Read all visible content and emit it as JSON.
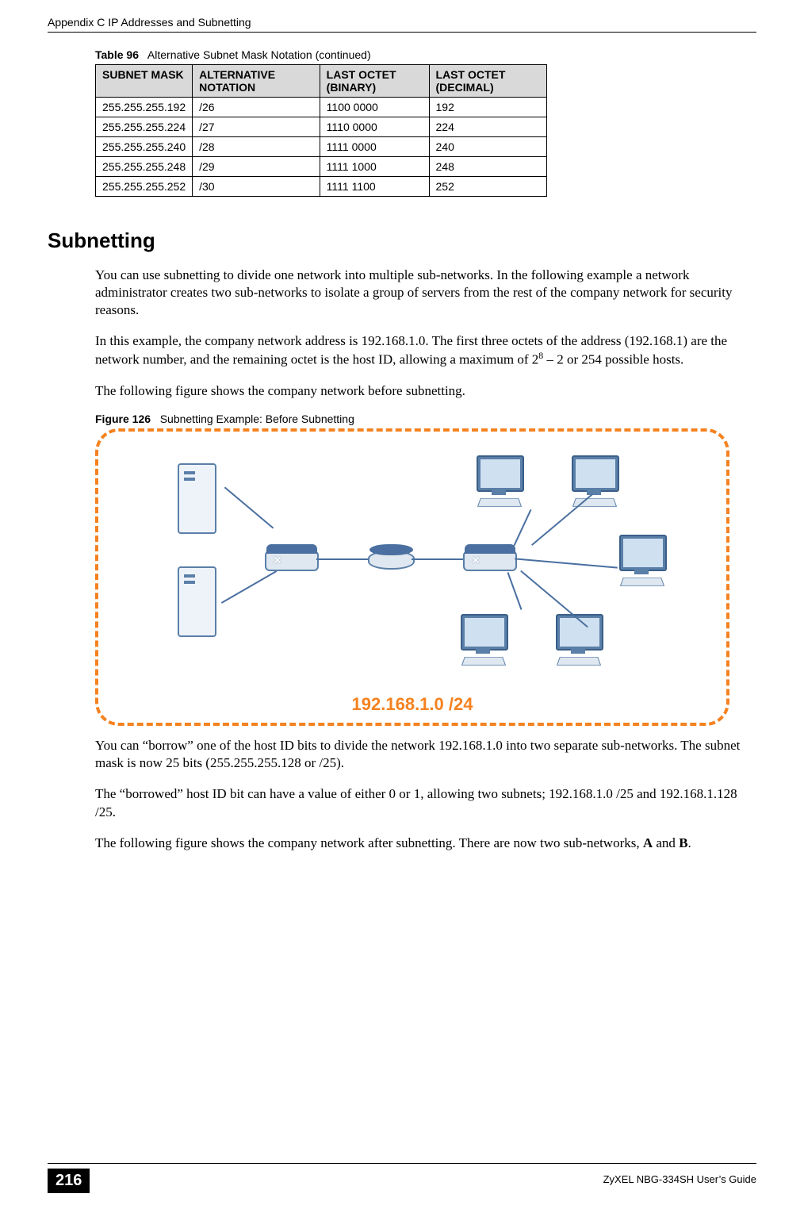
{
  "header": {
    "text": "Appendix C IP Addresses and Subnetting"
  },
  "table": {
    "caption_prefix": "Table 96",
    "caption_text": "Alternative Subnet Mask Notation (continued)",
    "headers": [
      "SUBNET MASK",
      "ALTERNATIVE NOTATION",
      "LAST OCTET (BINARY)",
      "LAST OCTET (DECIMAL)"
    ],
    "rows": [
      [
        "255.255.255.192",
        "/26",
        "1100 0000",
        "192"
      ],
      [
        "255.255.255.224",
        "/27",
        "1110 0000",
        "224"
      ],
      [
        "255.255.255.240",
        "/28",
        "1111 0000",
        "240"
      ],
      [
        "255.255.255.248",
        "/29",
        "1111 1000",
        "248"
      ],
      [
        "255.255.255.252",
        "/30",
        "1111 1100",
        "252"
      ]
    ]
  },
  "section": {
    "heading": "Subnetting"
  },
  "paragraphs": {
    "p1": "You can use subnetting to divide one network into multiple sub-networks. In the following example a network administrator creates two sub-networks to isolate a group of servers from the rest of the company network for security reasons.",
    "p2_pre": "In this example, the company network address is 192.168.1.0. The first three octets of the address (192.168.1) are the network number, and the remaining octet is the host ID, allowing a maximum of 2",
    "p2_sup": "8",
    "p2_post": " – 2 or 254 possible hosts.",
    "p3": "The following figure shows the company network before subnetting.",
    "p4": "You can “borrow” one of the host ID bits to divide the network 192.168.1.0 into two separate sub-networks. The subnet mask is now 25 bits (255.255.255.128 or /25).",
    "p5": "The “borrowed” host ID bit can have a value of either 0 or 1, allowing two subnets; 192.168.1.0 /25 and 192.168.1.128 /25.",
    "p6_pre": "The following figure shows the company network after subnetting. There are now two sub-networks, ",
    "p6_a": "A",
    "p6_mid": " and ",
    "p6_b": "B",
    "p6_post": "."
  },
  "figure": {
    "caption_prefix": "Figure 126",
    "caption_text": "Subnetting Example: Before Subnetting",
    "network_label": "192.168.1.0 /24"
  },
  "footer": {
    "page_number": "216",
    "guide": "ZyXEL NBG-334SH User’s Guide"
  }
}
